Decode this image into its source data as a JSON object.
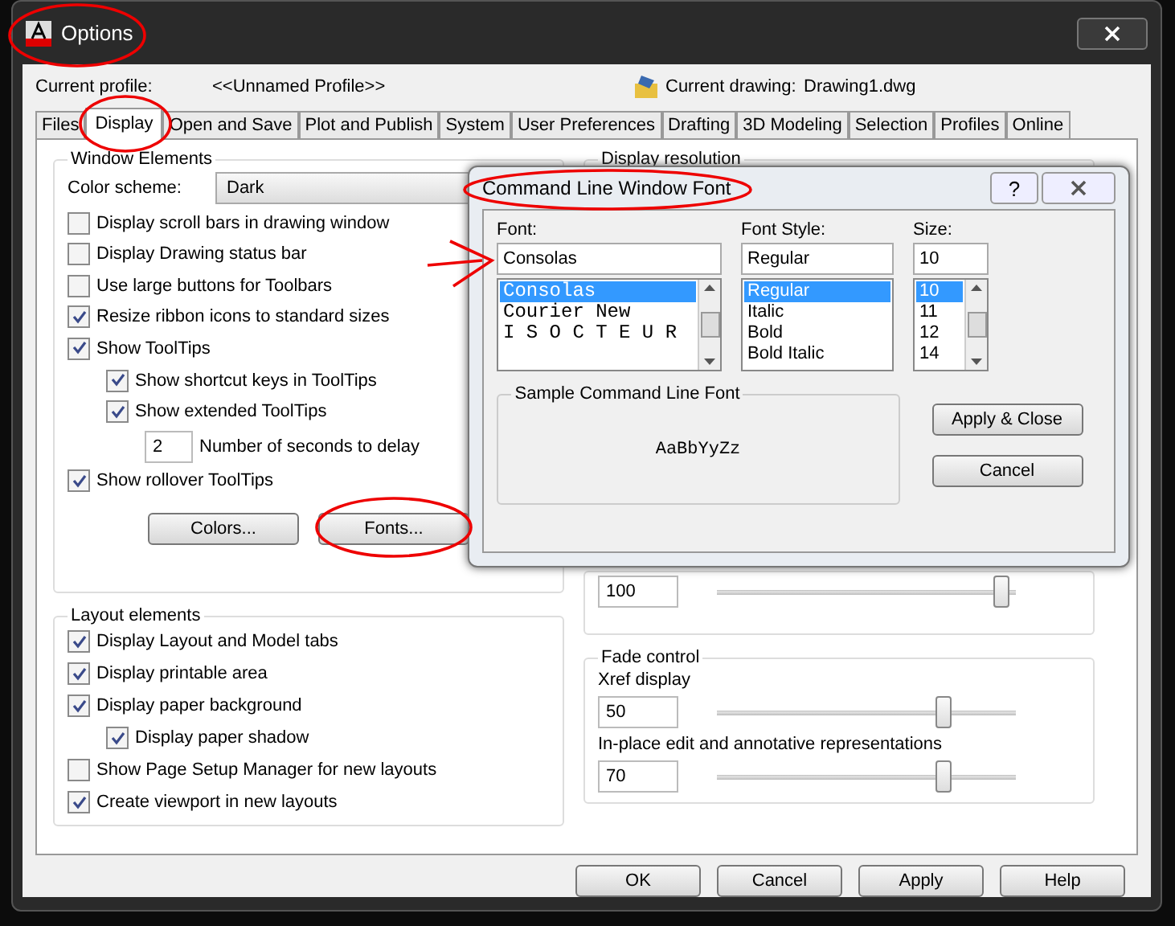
{
  "window": {
    "title": "Options"
  },
  "profile": {
    "label": "Current profile:",
    "value": "<<Unnamed Profile>>",
    "drawing_label": "Current drawing:",
    "drawing_value": "Drawing1.dwg"
  },
  "tabs": [
    {
      "label": "Files",
      "selected": false
    },
    {
      "label": "Display",
      "selected": true
    },
    {
      "label": "Open and Save",
      "selected": false
    },
    {
      "label": "Plot and Publish",
      "selected": false
    },
    {
      "label": "System",
      "selected": false
    },
    {
      "label": "User Preferences",
      "selected": false
    },
    {
      "label": "Drafting",
      "selected": false
    },
    {
      "label": "3D Modeling",
      "selected": false
    },
    {
      "label": "Selection",
      "selected": false
    },
    {
      "label": "Profiles",
      "selected": false
    },
    {
      "label": "Online",
      "selected": false
    }
  ],
  "window_elements": {
    "title": "Window Elements",
    "color_scheme_label": "Color scheme:",
    "color_scheme": "Dark",
    "options": [
      {
        "kind": "check",
        "label": "Display scroll bars in drawing window",
        "checked": false
      },
      {
        "kind": "check",
        "label": "Display Drawing status bar",
        "checked": false
      },
      {
        "kind": "check",
        "label": "Use large buttons for Toolbars",
        "checked": false
      },
      {
        "kind": "check",
        "label": "Resize ribbon icons to standard sizes",
        "checked": true
      },
      {
        "kind": "check",
        "label": "Show ToolTips",
        "checked": true,
        "children": [
          {
            "kind": "check",
            "label": "Show shortcut keys in ToolTips",
            "checked": true
          },
          {
            "kind": "check",
            "label": "Show extended ToolTips",
            "checked": true
          },
          {
            "kind": "number",
            "value": "2",
            "label": "Number of seconds to delay"
          }
        ]
      },
      {
        "kind": "check",
        "label": "Show rollover ToolTips",
        "checked": true
      }
    ],
    "buttons": [
      "Colors...",
      "Fonts..."
    ]
  },
  "layout_elements": {
    "title": "Layout elements",
    "options": [
      {
        "label": "Display Layout and Model tabs",
        "checked": true
      },
      {
        "label": "Display printable area",
        "checked": true
      },
      {
        "label": "Display paper background",
        "checked": true,
        "children": [
          {
            "label": "Display paper shadow",
            "checked": true
          }
        ]
      },
      {
        "label": "Show Page Setup Manager for new layouts",
        "checked": false
      },
      {
        "label": "Create viewport in new layouts",
        "checked": true
      }
    ]
  },
  "display_resolution": {
    "title": "Display resolution"
  },
  "crosshair": {
    "value": "100",
    "level": 0.98
  },
  "fade_control": {
    "title": "Fade control",
    "items": [
      {
        "label": "Xref display",
        "value": "50",
        "level": 0.77
      },
      {
        "label": "In-place edit and annotative representations",
        "value": "70",
        "level": 0.77
      }
    ]
  },
  "buttons": [
    "OK",
    "Cancel",
    "Apply",
    "Help"
  ],
  "font_dialog": {
    "title": "Command Line Window Font",
    "help": "?",
    "font_label": "Font:",
    "font_value": "Consolas",
    "fonts": [
      {
        "label": "Consolas",
        "selected": true
      },
      {
        "label": "Courier New",
        "selected": false
      },
      {
        "label": "I S O C T E U R",
        "selected": false
      }
    ],
    "style_label": "Font Style:",
    "style_value": "Regular",
    "styles": [
      {
        "label": "Regular",
        "selected": true
      },
      {
        "label": "Italic",
        "selected": false
      },
      {
        "label": "Bold",
        "selected": false
      },
      {
        "label": "Bold Italic",
        "selected": false
      }
    ],
    "size_label": "Size:",
    "size_value": "10",
    "sizes": [
      {
        "label": "10",
        "selected": true
      },
      {
        "label": "11",
        "selected": false
      },
      {
        "label": "12",
        "selected": false
      },
      {
        "label": "14",
        "selected": false
      }
    ],
    "sample_title": "Sample Command Line Font",
    "sample_text": "AaBbYyZz",
    "buttons": [
      "Apply & Close",
      "Cancel"
    ]
  }
}
